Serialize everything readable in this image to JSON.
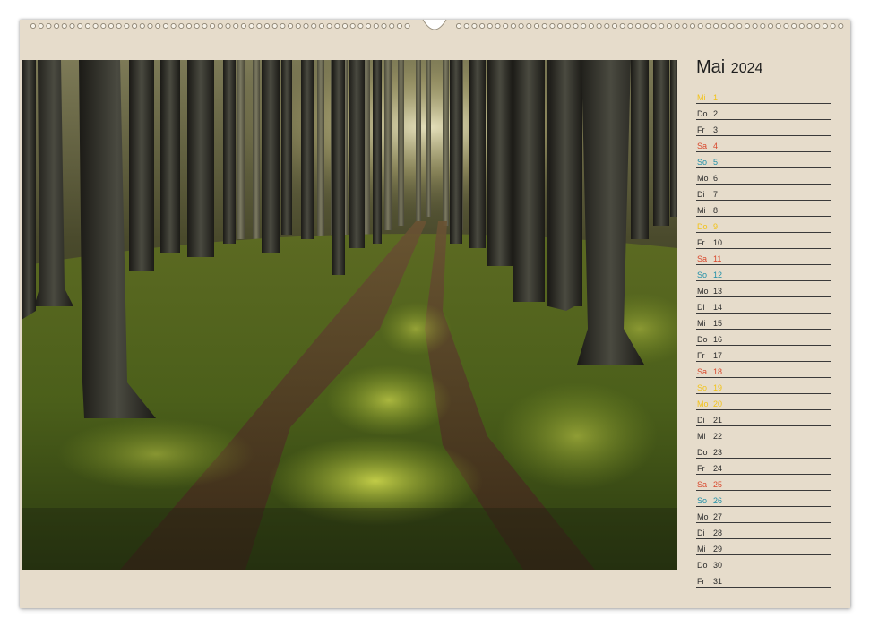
{
  "calendar": {
    "month": "Mai",
    "year": "2024",
    "colors": {
      "weekday": "#2b2b2b",
      "saturday": "#d9472b",
      "sunday": "#1f8fa8",
      "holiday": "#f2c318",
      "paper": "#e6dccb"
    },
    "days": [
      {
        "wd": "Mi",
        "d": "1",
        "type": "holiday"
      },
      {
        "wd": "Do",
        "d": "2",
        "type": "weekday"
      },
      {
        "wd": "Fr",
        "d": "3",
        "type": "weekday"
      },
      {
        "wd": "Sa",
        "d": "4",
        "type": "saturday"
      },
      {
        "wd": "So",
        "d": "5",
        "type": "sunday"
      },
      {
        "wd": "Mo",
        "d": "6",
        "type": "weekday"
      },
      {
        "wd": "Di",
        "d": "7",
        "type": "weekday"
      },
      {
        "wd": "Mi",
        "d": "8",
        "type": "weekday"
      },
      {
        "wd": "Do",
        "d": "9",
        "type": "holiday"
      },
      {
        "wd": "Fr",
        "d": "10",
        "type": "weekday"
      },
      {
        "wd": "Sa",
        "d": "11",
        "type": "saturday"
      },
      {
        "wd": "So",
        "d": "12",
        "type": "sunday"
      },
      {
        "wd": "Mo",
        "d": "13",
        "type": "weekday"
      },
      {
        "wd": "Di",
        "d": "14",
        "type": "weekday"
      },
      {
        "wd": "Mi",
        "d": "15",
        "type": "weekday"
      },
      {
        "wd": "Do",
        "d": "16",
        "type": "weekday"
      },
      {
        "wd": "Fr",
        "d": "17",
        "type": "weekday"
      },
      {
        "wd": "Sa",
        "d": "18",
        "type": "saturday"
      },
      {
        "wd": "So",
        "d": "19",
        "type": "holiday"
      },
      {
        "wd": "Mo",
        "d": "20",
        "type": "holiday"
      },
      {
        "wd": "Di",
        "d": "21",
        "type": "weekday"
      },
      {
        "wd": "Mi",
        "d": "22",
        "type": "weekday"
      },
      {
        "wd": "Do",
        "d": "23",
        "type": "weekday"
      },
      {
        "wd": "Fr",
        "d": "24",
        "type": "weekday"
      },
      {
        "wd": "Sa",
        "d": "25",
        "type": "saturday"
      },
      {
        "wd": "So",
        "d": "26",
        "type": "sunday"
      },
      {
        "wd": "Mo",
        "d": "27",
        "type": "weekday"
      },
      {
        "wd": "Di",
        "d": "28",
        "type": "weekday"
      },
      {
        "wd": "Mi",
        "d": "29",
        "type": "weekday"
      },
      {
        "wd": "Do",
        "d": "30",
        "type": "weekday"
      },
      {
        "wd": "Fr",
        "d": "31",
        "type": "weekday"
      }
    ]
  }
}
